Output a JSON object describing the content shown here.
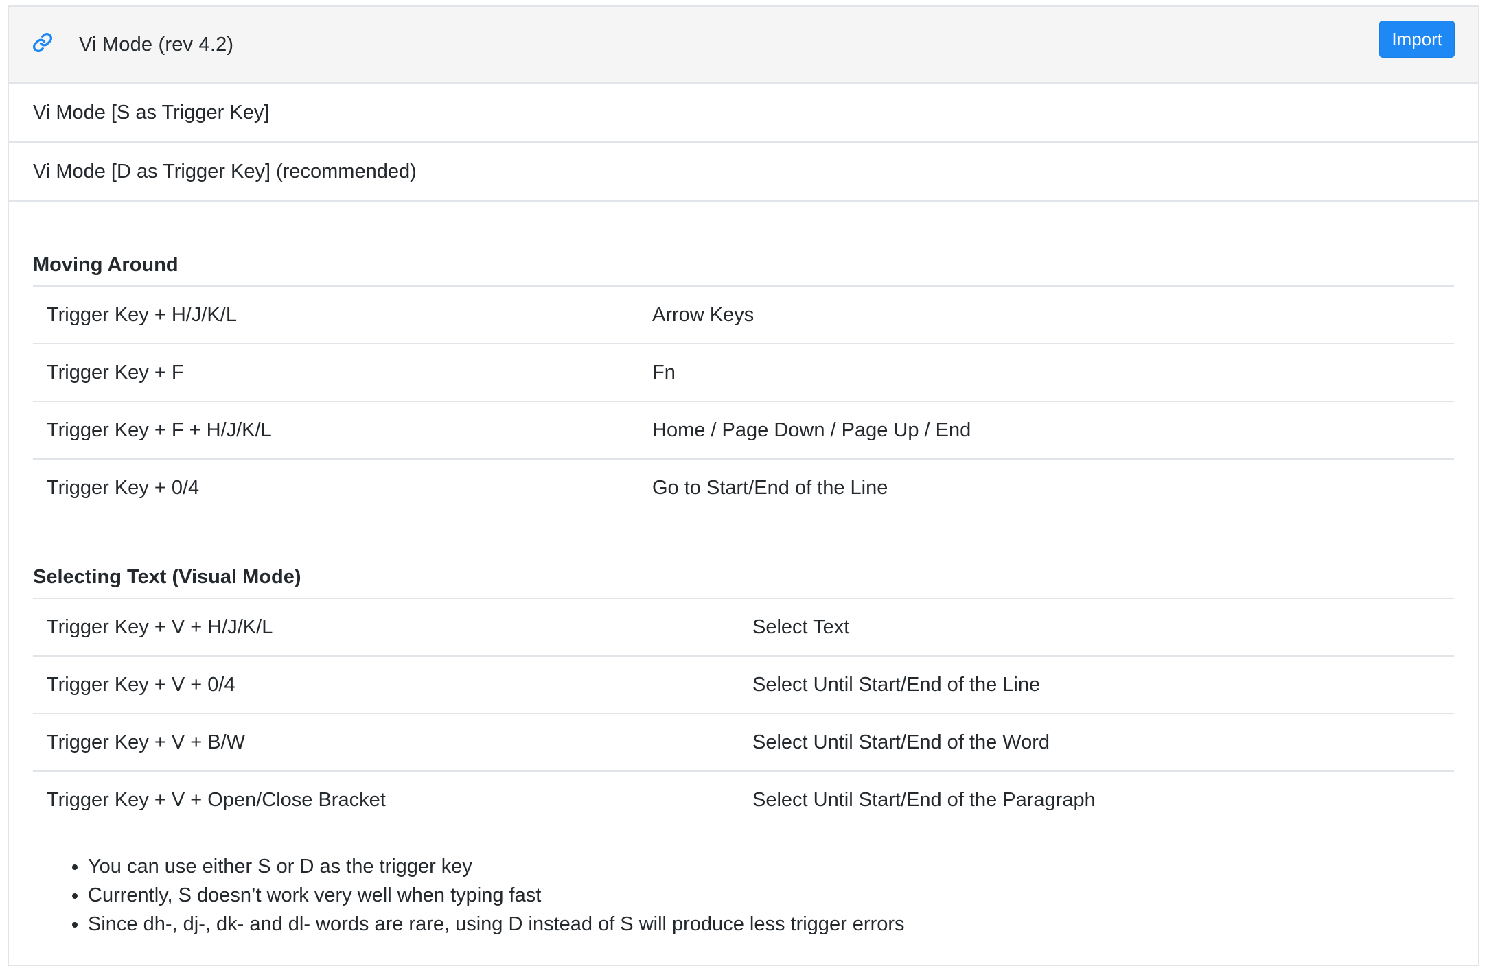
{
  "header": {
    "title": "Vi Mode (rev 4.2)",
    "import_label": "Import",
    "link_icon": "link-icon",
    "accent_color": "#1e88f5"
  },
  "variants": [
    {
      "label": "Vi Mode [S as Trigger Key]"
    },
    {
      "label": "Vi Mode [D as Trigger Key] (recommended)"
    }
  ],
  "sections": [
    {
      "title": "Moving Around",
      "rows": [
        {
          "key": "Trigger Key + H/J/K/L",
          "action": "Arrow Keys"
        },
        {
          "key": "Trigger Key + F",
          "action": "Fn"
        },
        {
          "key": "Trigger Key + F + H/J/K/L",
          "action": "Home / Page Down / Page Up / End"
        },
        {
          "key": "Trigger Key + 0/4",
          "action": "Go to Start/End of the Line"
        }
      ]
    },
    {
      "title": "Selecting Text (Visual Mode)",
      "rows": [
        {
          "key": "Trigger Key + V + H/J/K/L",
          "action": "Select Text"
        },
        {
          "key": "Trigger Key + V + 0/4",
          "action": "Select Until Start/End of the Line"
        },
        {
          "key": "Trigger Key + V + B/W",
          "action": "Select Until Start/End of the Word"
        },
        {
          "key": "Trigger Key + V + Open/Close Bracket",
          "action": "Select Until Start/End of the Paragraph"
        }
      ]
    }
  ],
  "notes": [
    "You can use either S or D as the trigger key",
    "Currently, S doesn’t work very well when typing fast",
    "Since dh-, dj-, dk- and dl- words are rare, using D instead of S will produce less trigger errors"
  ]
}
